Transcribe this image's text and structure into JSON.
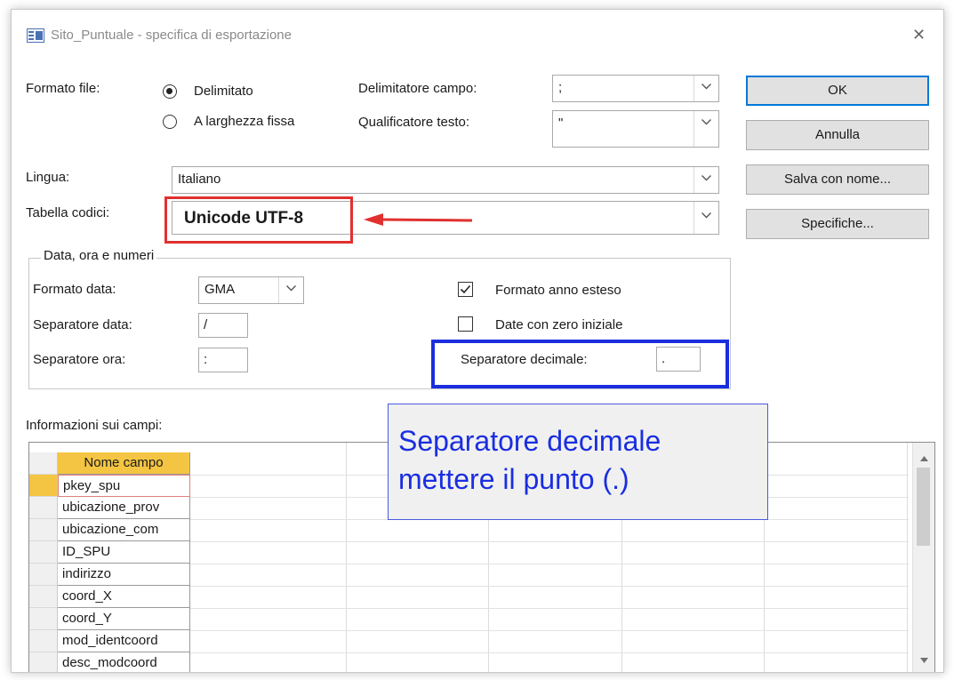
{
  "window": {
    "title": "Sito_Puntuale - specifica di esportazione",
    "close_glyph": "✕"
  },
  "format": {
    "label": "Formato file:",
    "options": [
      "Delimitato",
      "A larghezza fissa"
    ],
    "selected": "Delimitato"
  },
  "delimiter": {
    "label": "Delimitatore campo:",
    "value": ";"
  },
  "qualifier": {
    "label": "Qualificatore testo:",
    "value": "\""
  },
  "language": {
    "label": "Lingua:",
    "value": "Italiano"
  },
  "codepage": {
    "label": "Tabella codici:",
    "value": "Unicode UTF-8"
  },
  "datetime": {
    "group_title": "Data, ora e numeri",
    "date_format_label": "Formato data:",
    "date_format_value": "GMA",
    "date_sep_label": "Separatore data:",
    "date_sep_value": "/",
    "time_sep_label": "Separatore ora:",
    "time_sep_value": ":",
    "four_digit_year_label": "Formato anno esteso",
    "four_digit_year_checked": true,
    "leading_zero_label": "Date con zero iniziale",
    "leading_zero_checked": false,
    "decimal_sep_label": "Separatore decimale:",
    "decimal_sep_value": "."
  },
  "buttons": {
    "ok": "OK",
    "cancel": "Annulla",
    "save_as": "Salva con nome...",
    "specs": "Specifiche..."
  },
  "fields": {
    "label": "Informazioni sui campi:",
    "column_header": "Nome campo",
    "rows": [
      "pkey_spu",
      "ubicazione_prov",
      "ubicazione_com",
      "ID_SPU",
      "indirizzo",
      "coord_X",
      "coord_Y",
      "mod_identcoord",
      "desc_modcoord"
    ]
  },
  "annotation": {
    "callout_line1": "Separatore decimale",
    "callout_line2": "mettere il punto (.)",
    "red_color": "#e03030",
    "blue_color": "#1a2ee0"
  }
}
